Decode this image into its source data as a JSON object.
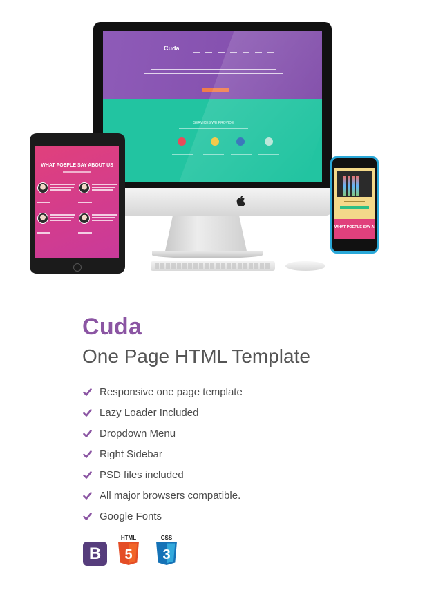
{
  "hero": {
    "ipad_heading": "WHAT POEPLE SAY ABOUT US",
    "phone_heading": "WHAT POEPLE SAY ABOUT",
    "imac_logo": "Cuda",
    "imac_services": "SERVICES WE PROVIDE"
  },
  "product": {
    "title": "Cuda",
    "subtitle": "One Page HTML Template"
  },
  "features": [
    "Responsive one page template",
    "Lazy Loader Included",
    "Dropdown Menu",
    "Right Sidebar",
    "PSD files included",
    "All major browsers compatible.",
    "Google Fonts"
  ],
  "badges": {
    "bootstrap": "B",
    "html": "HTML",
    "html_number": "5",
    "css": "CSS",
    "css_number": "3"
  },
  "colors": {
    "accent": "#8b55a3",
    "bootstrap": "#563d7c",
    "html5": "#e44d26",
    "css3": "#1572b6"
  },
  "icons": {
    "check": "check-icon",
    "apple": "apple-logo-icon"
  }
}
